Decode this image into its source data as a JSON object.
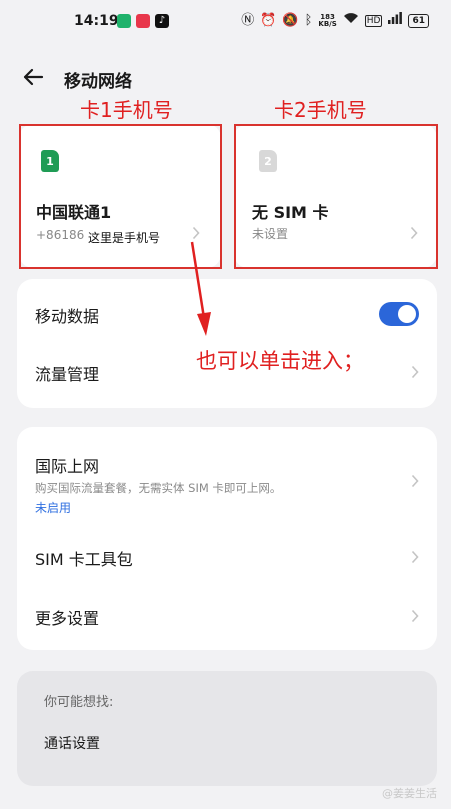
{
  "status_bar": {
    "time": "14:19",
    "net_speed_value": "183",
    "net_speed_unit": "KB/S",
    "battery": "61",
    "app_icon_colors": [
      "#1fb26b",
      "#e8374b",
      "#111111"
    ]
  },
  "header": {
    "title": "移动网络"
  },
  "annotations": {
    "sim1_label": "卡1手机号",
    "sim2_label": "卡2手机号",
    "phone_note": "这里是手机号",
    "tap_hint": "也可以单击进入；"
  },
  "sims": [
    {
      "slot": "1",
      "name": "中国联通1",
      "number": "+86186",
      "badge_color": "#1f9c55"
    },
    {
      "slot": "2",
      "name": "无 SIM 卡",
      "status": "未设置",
      "badge_color": "#d8d8d8"
    }
  ],
  "data_card": {
    "mobile_data_label": "移动数据",
    "mobile_data_on": true,
    "traffic_label": "流量管理"
  },
  "services_card": {
    "intl_label": "国际上网",
    "intl_desc": "购买国际流量套餐，无需实体 SIM 卡即可上网。",
    "intl_status": "未启用",
    "toolkit_label": "SIM 卡工具包",
    "more_label": "更多设置"
  },
  "suggest": {
    "heading": "你可能想找:",
    "item": "通话设置"
  },
  "watermark": "@姜姜生活",
  "colors": {
    "accent": "#2b66d9",
    "annotation": "#e02020"
  }
}
